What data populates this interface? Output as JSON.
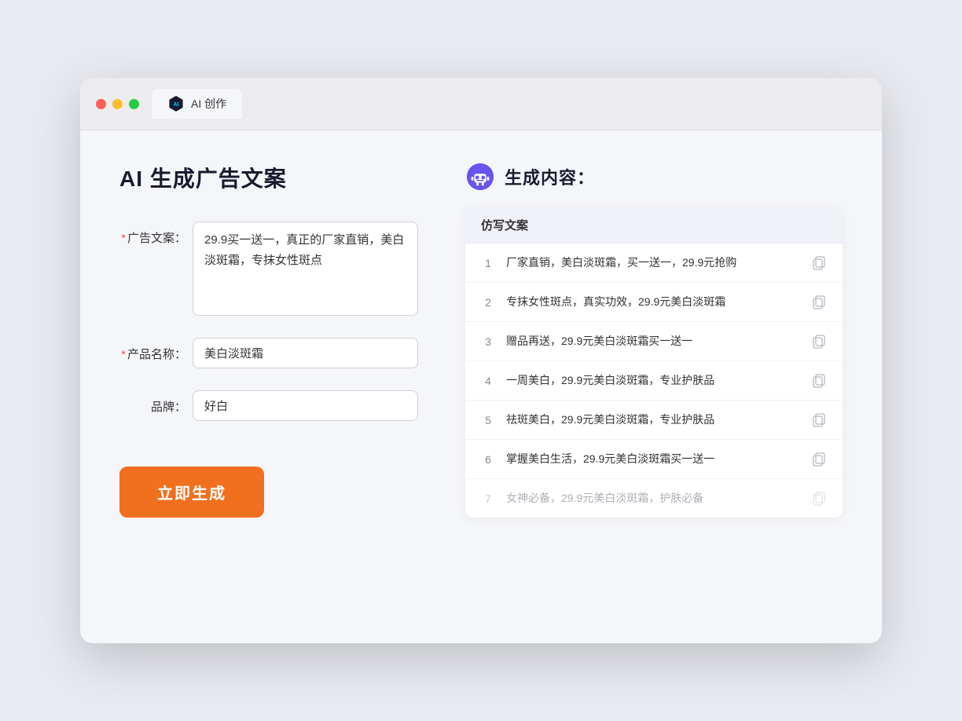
{
  "tab": {
    "label": "AI 创作"
  },
  "left": {
    "title": "AI 生成广告文案",
    "fields": [
      {
        "label": "广告文案：",
        "required": true,
        "type": "textarea",
        "value": "29.9买一送一，真正的厂家直销，美白淡斑霜，专抹女性斑点",
        "name": "ad-copy-input"
      },
      {
        "label": "产品名称：",
        "required": true,
        "type": "input",
        "value": "美白淡斑霜",
        "name": "product-name-input"
      },
      {
        "label": "品牌：",
        "required": false,
        "type": "input",
        "value": "好白",
        "name": "brand-input"
      }
    ],
    "button_label": "立即生成"
  },
  "right": {
    "title": "生成内容：",
    "table_header": "仿写文案",
    "results": [
      {
        "num": "1",
        "text": "厂家直销，美白淡斑霜，买一送一，29.9元抢购",
        "muted": false
      },
      {
        "num": "2",
        "text": "专抹女性斑点，真实功效，29.9元美白淡斑霜",
        "muted": false
      },
      {
        "num": "3",
        "text": "赠品再送，29.9元美白淡斑霜买一送一",
        "muted": false
      },
      {
        "num": "4",
        "text": "一周美白，29.9元美白淡斑霜，专业护肤品",
        "muted": false
      },
      {
        "num": "5",
        "text": "祛斑美白，29.9元美白淡斑霜，专业护肤品",
        "muted": false
      },
      {
        "num": "6",
        "text": "掌握美白生活，29.9元美白淡斑霜买一送一",
        "muted": false
      },
      {
        "num": "7",
        "text": "女神必备，29.9元美白淡斑霜，护肤必备",
        "muted": true
      }
    ]
  }
}
